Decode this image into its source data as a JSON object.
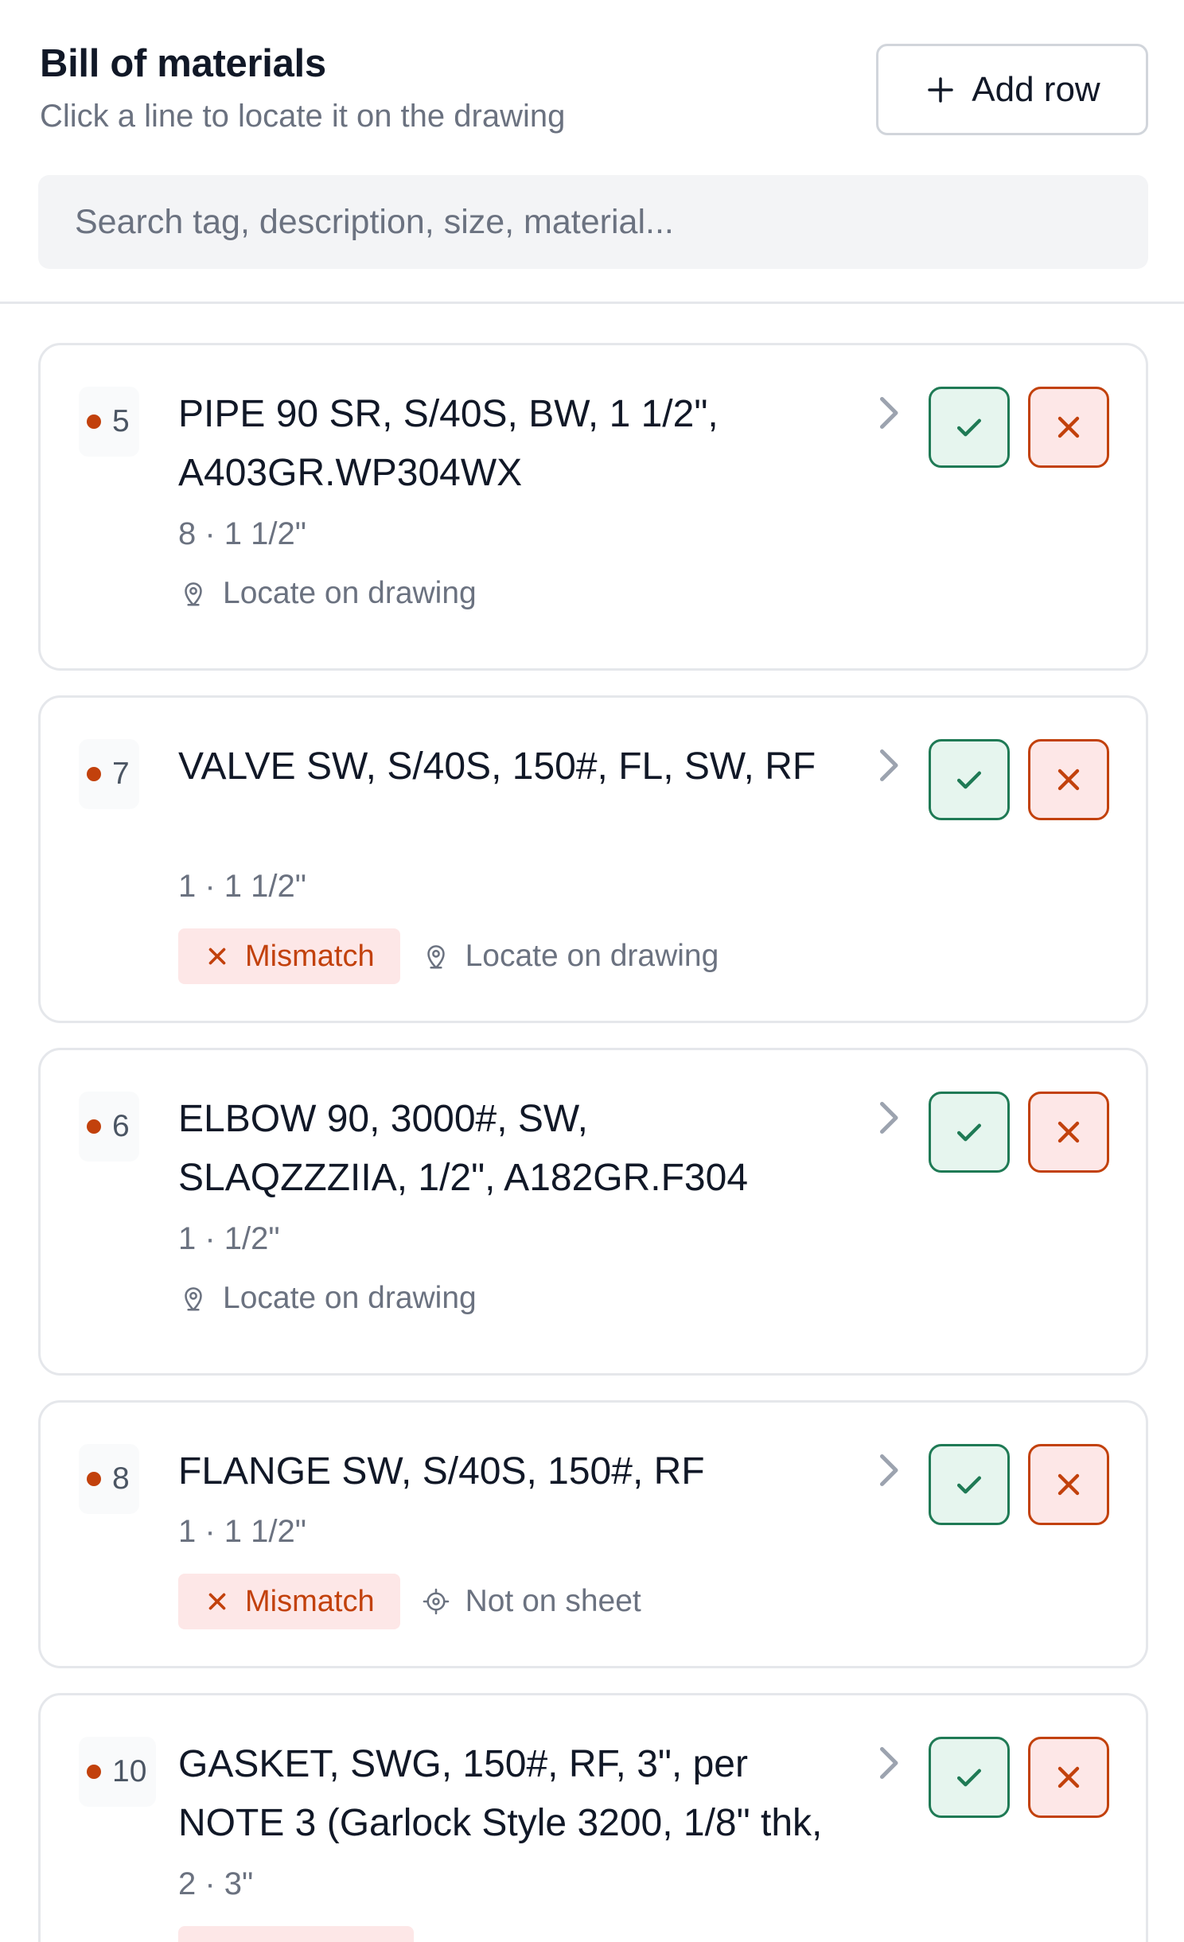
{
  "header": {
    "title": "Bill of materials",
    "subtitle": "Click a line to locate it on the drawing",
    "add_row_label": "Add row",
    "search_placeholder": "Search tag, description, size, material..."
  },
  "colors": {
    "accent_tag_dot": "#c2410c",
    "approve": "#1f7a55",
    "reject": "#c2410c",
    "mismatch_bg": "#fde7e7"
  },
  "items": [
    {
      "tag": "5",
      "description_line1": "PIPE 90 SR, S/40S, BW, 1 1/2\",",
      "description_line2": "A403GR.WP304WX",
      "meta": "8 · 1 1/2\"",
      "status": "",
      "location": "Locate on drawing"
    },
    {
      "tag": "7",
      "description_line1": "VALVE SW, S/40S, 150#, FL, SW, RF",
      "description_line2": "",
      "meta": "1 · 1 1/2\"",
      "status": "Mismatch",
      "location": "Locate on drawing"
    },
    {
      "tag": "6",
      "description_line1": "ELBOW 90, 3000#, SW,",
      "description_line2": "SLAQZZZIIA, 1/2\", A182GR.F304",
      "meta": "1 · 1/2\"",
      "status": "",
      "location": "Locate on drawing"
    },
    {
      "tag": "8",
      "description_line1": "FLANGE SW, S/40S, 150#, RF",
      "description_line2": "",
      "meta": "1 · 1 1/2\"",
      "status": "Mismatch",
      "location": "Not on sheet"
    },
    {
      "tag": "10",
      "description_line1": "GASKET, SWG, 150#, RF, 3\", per",
      "description_line2": "NOTE 3 (Garlock Style 3200, 1/8\" thk,",
      "meta": "2 · 3\"",
      "status": "",
      "location": ""
    }
  ]
}
